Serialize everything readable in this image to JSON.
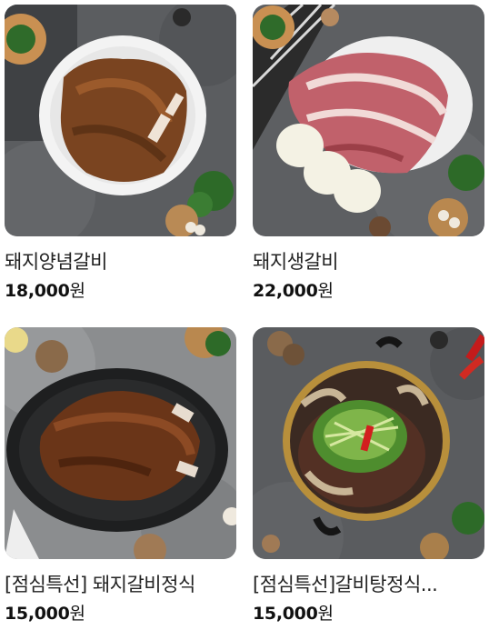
{
  "products": [
    {
      "name": "돼지양념갈비",
      "price": "18,000",
      "currency": "원",
      "image_icon": "marinated-pork-ribs-photo"
    },
    {
      "name": "돼지생갈비",
      "price": "22,000",
      "currency": "원",
      "image_icon": "raw-pork-ribs-photo"
    },
    {
      "name": "[점심특선] 돼지갈비정식",
      "price": "15,000",
      "currency": "원",
      "image_icon": "grilled-pork-ribs-platter-photo"
    },
    {
      "name": "[점심특선]갈비탕정식...",
      "price": "15,000",
      "currency": "원",
      "image_icon": "galbitang-hotpot-photo"
    }
  ],
  "colors": {
    "background": "#ffffff",
    "stone_backdrop": "#5f6163",
    "name_text": "#222222",
    "price_text": "#111111"
  }
}
